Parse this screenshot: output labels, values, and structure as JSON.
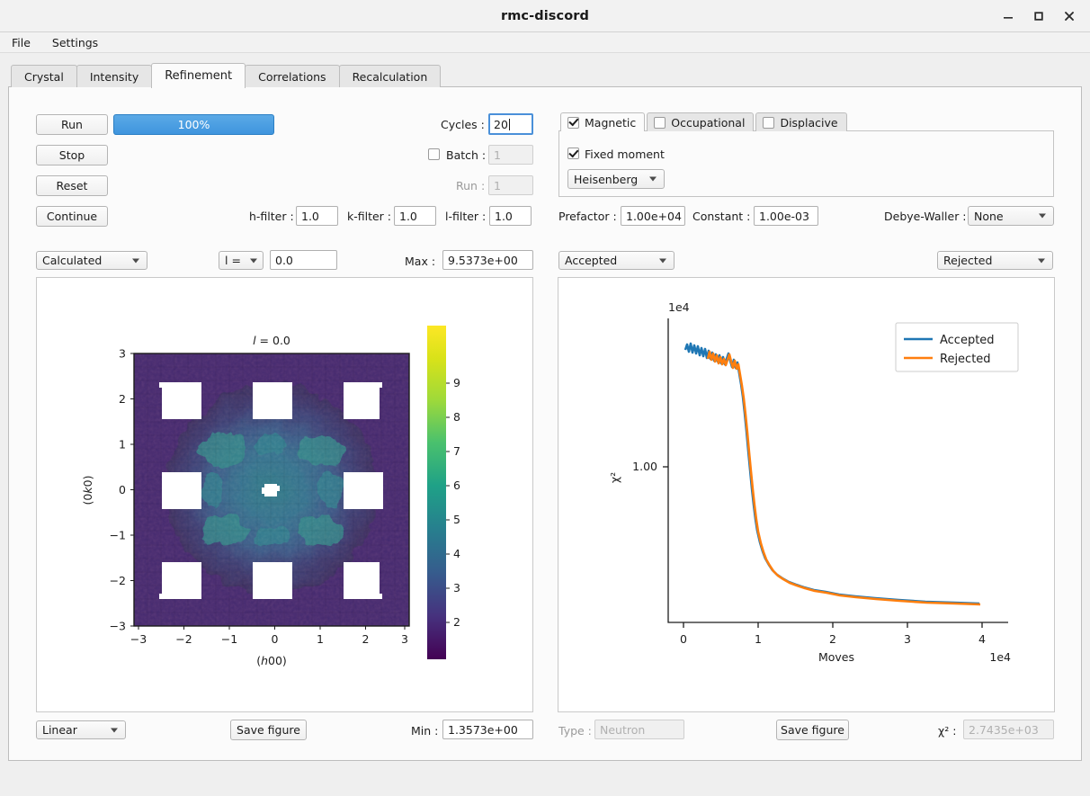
{
  "window": {
    "title": "rmc-discord",
    "buttons": {
      "minimize": "minimize-icon",
      "maximize": "maximize-icon",
      "close": "close-icon"
    }
  },
  "menubar": {
    "items": [
      {
        "label": "File"
      },
      {
        "label": "Settings"
      }
    ]
  },
  "tabs": [
    {
      "label": "Crystal",
      "active": false
    },
    {
      "label": "Intensity",
      "active": false
    },
    {
      "label": "Refinement",
      "active": true
    },
    {
      "label": "Correlations",
      "active": false
    },
    {
      "label": "Recalculation",
      "active": false
    }
  ],
  "controls": {
    "run_label": "Run",
    "stop_label": "Stop",
    "reset_label": "Reset",
    "continue_label": "Continue",
    "progress_text": "100%",
    "progress_percent": 100,
    "progress_color": "#3f95de",
    "cycles_label": "Cycles :",
    "cycles_value": "20",
    "batch_label": "Batch :",
    "batch_checked": false,
    "batch_value": "1",
    "run_field_label": "Run :",
    "run_field_value": "1",
    "h_filter_label": "h-filter :",
    "h_filter_value": "1.0",
    "k_filter_label": "k-filter :",
    "k_filter_value": "1.0",
    "l_filter_label": "l-filter :",
    "l_filter_value": "1.0"
  },
  "disorder": {
    "tabs": [
      {
        "label": "Magnetic",
        "checked": true,
        "active": true
      },
      {
        "label": "Occupational",
        "checked": false,
        "active": false
      },
      {
        "label": "Displacive",
        "checked": false,
        "active": false
      }
    ],
    "fixed_moment_label": "Fixed moment",
    "fixed_moment_checked": true,
    "model_value": "Heisenberg",
    "prefactor_label": "Prefactor :",
    "prefactor_value": "1.00e+04",
    "constant_label": "Constant :",
    "constant_value": "1.00e-03",
    "debye_waller_label": "Debye-Waller :",
    "debye_waller_value": "None"
  },
  "left_plot_controls": {
    "data_select_value": "Calculated",
    "slice_select_value": "l =",
    "slice_value": "0.0",
    "max_label": "Max :",
    "max_value": "9.5373e+00",
    "scale_select_value": "Linear",
    "save_figure_label": "Save figure",
    "min_label": "Min :",
    "min_value": "1.3573e+00"
  },
  "right_plot_controls": {
    "left_select_value": "Accepted",
    "right_select_value": "Rejected",
    "type_label": "Type :",
    "type_value": "Neutron",
    "save_figure_label": "Save figure",
    "chi_label": "χ² :",
    "chi_value": "2.7435e+03"
  },
  "chart_data": [
    {
      "type": "heatmap",
      "title": "l = 0.0",
      "xlabel": "(h00)",
      "ylabel": "(0k0)",
      "xticks": [
        -3,
        -2,
        -1,
        0,
        1,
        2,
        3
      ],
      "yticks": [
        -3,
        -2,
        -1,
        0,
        1,
        2,
        3
      ],
      "xlim": [
        -3.25,
        3.25
      ],
      "ylim": [
        -3.25,
        3.25
      ],
      "colormap": "viridis",
      "colorbar_ticks": [
        2,
        3,
        4,
        5,
        6,
        7,
        8,
        9
      ],
      "vmin": 1.3573,
      "vmax": 9.5373,
      "grid": false,
      "masked_color": "#ffffff",
      "description": "Diffuse magnetic scattering slice; bright diffuse cross/ring structure near the centre fading to dark at the edges, with Bragg peak regions masked out in white on a 3x3 lattice of positions plus a small central mask.",
      "masked_blocks": [
        {
          "x": -2.0,
          "y": 2.0
        },
        {
          "x": 0.0,
          "y": 2.0
        },
        {
          "x": 2.0,
          "y": 2.0
        },
        {
          "x": -2.0,
          "y": 0.0
        },
        {
          "x": 2.0,
          "y": 0.0
        },
        {
          "x": -2.0,
          "y": -2.0
        },
        {
          "x": 0.0,
          "y": -2.0
        },
        {
          "x": 2.0,
          "y": -2.0
        },
        {
          "x": 0.0,
          "y": 0.0
        }
      ]
    },
    {
      "type": "line",
      "title": "",
      "xlabel": "Moves",
      "ylabel": "χ²",
      "x_exponent_label": "1e4",
      "y_exponent_label": "1e4",
      "xticks": [
        0,
        1,
        2,
        3,
        4
      ],
      "yticks": [
        1.0
      ],
      "ytick_labels": [
        "1.00"
      ],
      "xlim": [
        -0.15,
        4.4
      ],
      "ylim": [
        0,
        1.95
      ],
      "grid": false,
      "legend_position": "upper right",
      "series": [
        {
          "name": "Accepted",
          "color": "#1f77b4",
          "x": [
            0.02,
            0.05,
            0.08,
            0.11,
            0.14,
            0.17,
            0.2,
            0.23,
            0.26,
            0.29,
            0.32,
            0.35,
            0.38,
            0.41,
            0.44,
            0.47,
            0.5,
            0.53,
            0.56,
            0.59,
            0.62,
            0.66,
            0.7,
            0.75,
            0.8,
            0.9,
            1.0,
            1.2,
            1.5,
            2.0,
            2.5,
            3.0,
            3.5,
            4.1
          ],
          "y": [
            1.7,
            1.72,
            1.68,
            1.71,
            1.66,
            1.69,
            1.64,
            1.67,
            1.62,
            1.65,
            1.6,
            1.63,
            1.58,
            1.61,
            1.57,
            1.59,
            1.52,
            1.4,
            1.24,
            1.06,
            0.88,
            0.7,
            0.55,
            0.44,
            0.37,
            0.29,
            0.25,
            0.21,
            0.18,
            0.15,
            0.13,
            0.115,
            0.105,
            0.095
          ]
        },
        {
          "name": "Rejected",
          "color": "#ff7f0e",
          "x": [
            0.3,
            0.34,
            0.38,
            0.41,
            0.44,
            0.47,
            0.5,
            0.53,
            0.56,
            0.59,
            0.62,
            0.66,
            0.7,
            0.75,
            0.8,
            0.9,
            1.0,
            1.2,
            1.5,
            2.0,
            2.5,
            3.0,
            3.5,
            4.1
          ],
          "y": [
            1.62,
            1.66,
            1.57,
            1.6,
            1.56,
            1.58,
            1.51,
            1.39,
            1.23,
            1.05,
            0.87,
            0.69,
            0.545,
            0.435,
            0.365,
            0.285,
            0.247,
            0.207,
            0.177,
            0.148,
            0.128,
            0.113,
            0.103,
            0.093
          ]
        }
      ]
    }
  ]
}
